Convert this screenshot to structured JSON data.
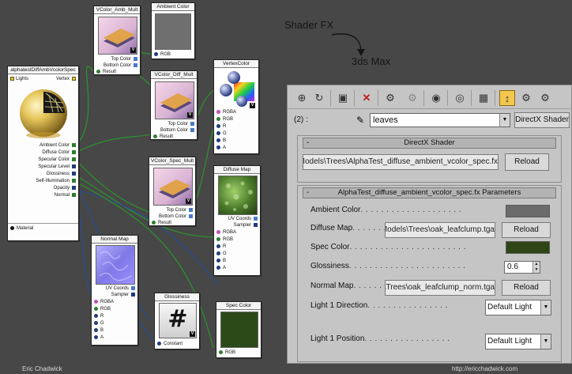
{
  "graph": {
    "main_node": {
      "title": "alphatestDiffAmbVcolorSpec",
      "top_left": "Lights",
      "top_right": "Vertex",
      "params": [
        "Ambient Color",
        "Diffuse Color",
        "Specular Color",
        "Specular Level",
        "Glossiness",
        "Self-Illumination",
        "Opacity",
        "Normal"
      ],
      "footer": "Material"
    },
    "amb_mult": {
      "title": "VColor_Amb_Mult",
      "top": "Top Color",
      "bottom": "Bottom Color",
      "result": "Result",
      "badge": "V"
    },
    "ambient_color": {
      "title": "Ambient Color",
      "out": "RGB"
    },
    "diff_mult": {
      "title": "VColor_Diff_Mult",
      "top": "Top Color",
      "bottom": "Bottom Color",
      "result": "Result",
      "badge": "V"
    },
    "vertex_color": {
      "title": "VertexColor",
      "outs": [
        "RGBA",
        "RGB",
        "R",
        "G",
        "B",
        "A"
      ],
      "badge": "V"
    },
    "spec_mult": {
      "title": "VColor_Spec_Mult",
      "top": "Top Color",
      "bottom": "Bottom Color",
      "result": "Result",
      "badge": "V"
    },
    "diffuse_map": {
      "title": "Diffuse Map",
      "uv": "UV Coords",
      "sampler": "Sampler",
      "outs": [
        "RGBA",
        "RGB",
        "R",
        "G",
        "B",
        "A"
      ]
    },
    "normal_map": {
      "title": "Normal Map",
      "uv": "UV Coords",
      "sampler": "Sampler",
      "outs": [
        "RGBA",
        "RGB",
        "R",
        "G",
        "B",
        "A"
      ]
    },
    "glossiness": {
      "title": "Glossiness",
      "glyph": "#",
      "out": "Constant",
      "badge": "V"
    },
    "spec_color": {
      "title": "Spec Color",
      "out": "RGB"
    }
  },
  "flow": {
    "from": "Shader FX",
    "to": "3ds Max"
  },
  "panel": {
    "material_count": "(2) :",
    "material_name": "leaves",
    "shader_type": "DirectX Shader",
    "directx_rollout": {
      "title": "DirectX Shader",
      "path": "C:\\Projects\\Content\\Models\\Trees\\AlphaTest_diffuse_ambient_vcolor_spec.fx",
      "reload": "Reload"
    },
    "params_rollout": {
      "title": "AlphaTest_diffuse_ambient_vcolor_spec.fx Parameters",
      "ambient_label": "Ambient Color",
      "diffuse_label": "Diffuse Map",
      "diffuse_path": "C:\\Projects\\Content\\Models\\Trees\\oak_leafclump.tga",
      "spec_label": "Spec Color",
      "gloss_label": "Glossiness",
      "gloss_value": "0.6",
      "normal_label": "Normal Map",
      "normal_path": "C:\\Projects\\Content\\Models\\Trees\\oak_leafclump_norm.tga",
      "light1_dir_label": "Light 1 Direction",
      "light1_dir_value": "Default Light",
      "light1_pos_label": "Light 1 Position",
      "light1_pos_value": "Default Light",
      "reload": "Reload"
    }
  },
  "colors": {
    "ambient_swatch": "#6b6b6b",
    "spec_swatch": "#2f4516",
    "spec_node_fill": "#2c4a18",
    "wire_green": "#2f8a2f",
    "wire_blue": "#2b4d8c",
    "active_tool": "#f3c64d"
  },
  "credits": {
    "left": "Eric Chadwick",
    "right": "http://ericchadwick.com"
  }
}
